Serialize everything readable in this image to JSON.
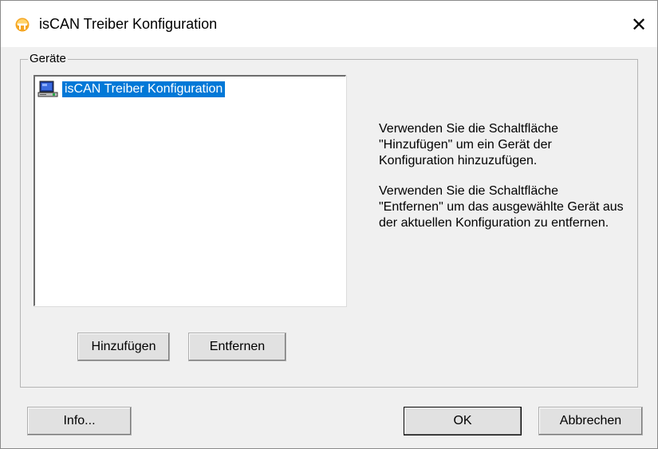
{
  "window": {
    "title": "isCAN Treiber Konfiguration",
    "close_glyph": "✕",
    "icon": "iscan-app-icon"
  },
  "devices_group": {
    "label": "Geräte",
    "list_items": [
      {
        "label": "isCAN Treiber Konfiguration",
        "icon": "computer-icon",
        "selected": true
      }
    ],
    "add_button": "Hinzufügen",
    "remove_button": "Entfernen"
  },
  "help": {
    "add_text": "Verwenden Sie die Schaltfläche \"Hinzufügen\" um ein Gerät der Konfiguration hinzuzufügen.",
    "remove_text": "Verwenden Sie die Schaltfläche \"Entfernen\" um das ausgewählte Gerät aus der aktuellen Konfiguration zu entfernen."
  },
  "footer": {
    "info_button": "Info...",
    "ok_button": "OK",
    "cancel_button": "Abbrechen"
  },
  "colors": {
    "selection": "#0078d7",
    "dialog_bg": "#f0f0f0",
    "icon_orange": "#f5a623"
  }
}
